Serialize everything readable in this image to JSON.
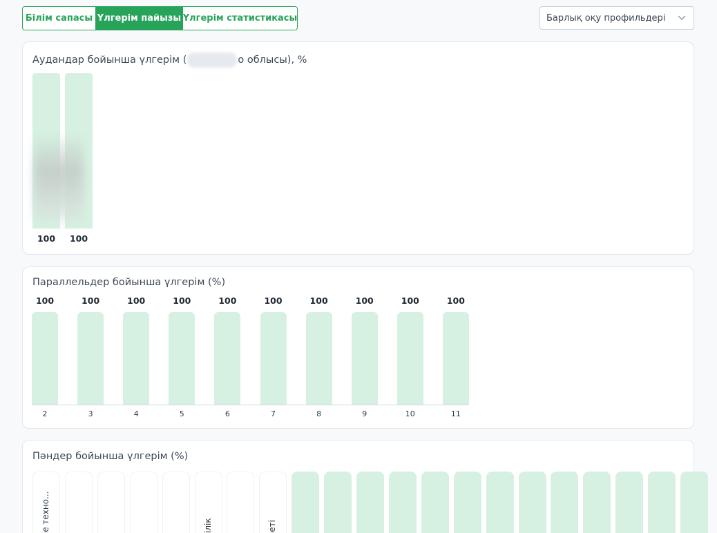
{
  "tabs": [
    {
      "label": "Білім сапасы",
      "active": false
    },
    {
      "label": "Үлгерім пайызы",
      "active": true
    },
    {
      "label": "Үлгерім статистикасы",
      "active": false
    }
  ],
  "profile_select": {
    "value": "Барлық оқу профильдері",
    "icon": "chevron-down-icon"
  },
  "colors": {
    "accent": "#28a35a",
    "bar": "#d6f1e1"
  },
  "card1": {
    "title_start": "Аудандар бойынша үлгерім (",
    "title_end": "о облысы), %"
  },
  "card2": {
    "title": "Параллельдер бойынша үлгерім (%)"
  },
  "card3": {
    "title": "Пәндер бойынша үлгерім (%)"
  },
  "chart_data": [
    {
      "type": "bar",
      "categories": [
        "",
        ""
      ],
      "values": [
        100,
        100
      ],
      "ylim": [
        0,
        100
      ]
    },
    {
      "type": "bar",
      "categories": [
        "2",
        "3",
        "4",
        "5",
        "6",
        "7",
        "8",
        "9",
        "10",
        "11"
      ],
      "values": [
        100,
        100,
        100,
        100,
        100,
        100,
        100,
        100,
        100,
        100
      ],
      "ylim": [
        0,
        100
      ]
    },
    {
      "type": "bar",
      "categories": [
        "әне техно...",
        "",
        "",
        "",
        "",
        "ттілік",
        "",
        "биеті",
        "",
        "",
        "",
        "",
        "",
        "",
        "",
        "",
        "",
        "",
        "",
        "",
        ""
      ],
      "filled": [
        false,
        false,
        false,
        false,
        false,
        false,
        false,
        false,
        true,
        true,
        true,
        true,
        true,
        true,
        true,
        true,
        true,
        true,
        true,
        true,
        true
      ]
    }
  ]
}
